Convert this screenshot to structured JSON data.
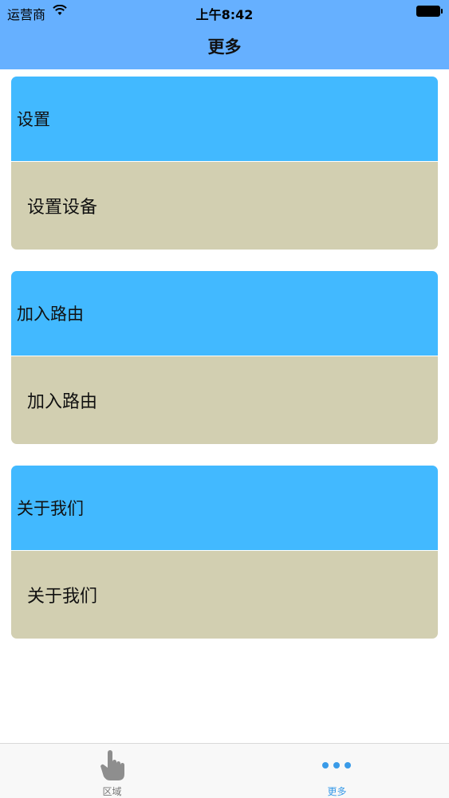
{
  "status_bar": {
    "carrier": "运营商",
    "time": "上午8:42"
  },
  "nav": {
    "title": "更多"
  },
  "sections": [
    {
      "header": "设置",
      "item": "设置设备"
    },
    {
      "header": "加入路由",
      "item": "加入路由"
    },
    {
      "header": "关于我们",
      "item": "关于我们"
    }
  ],
  "tab_bar": {
    "tabs": [
      {
        "label": "区域",
        "icon": "hand-pointer-icon",
        "selected": false
      },
      {
        "label": "更多",
        "icon": "more-dots-icon",
        "selected": true
      }
    ]
  },
  "colors": {
    "nav_background": "#66b0ff",
    "section_header": "#42b9ff",
    "section_item": "#d2cfb1",
    "tab_active": "#3a9be8",
    "tab_inactive": "#777777"
  }
}
